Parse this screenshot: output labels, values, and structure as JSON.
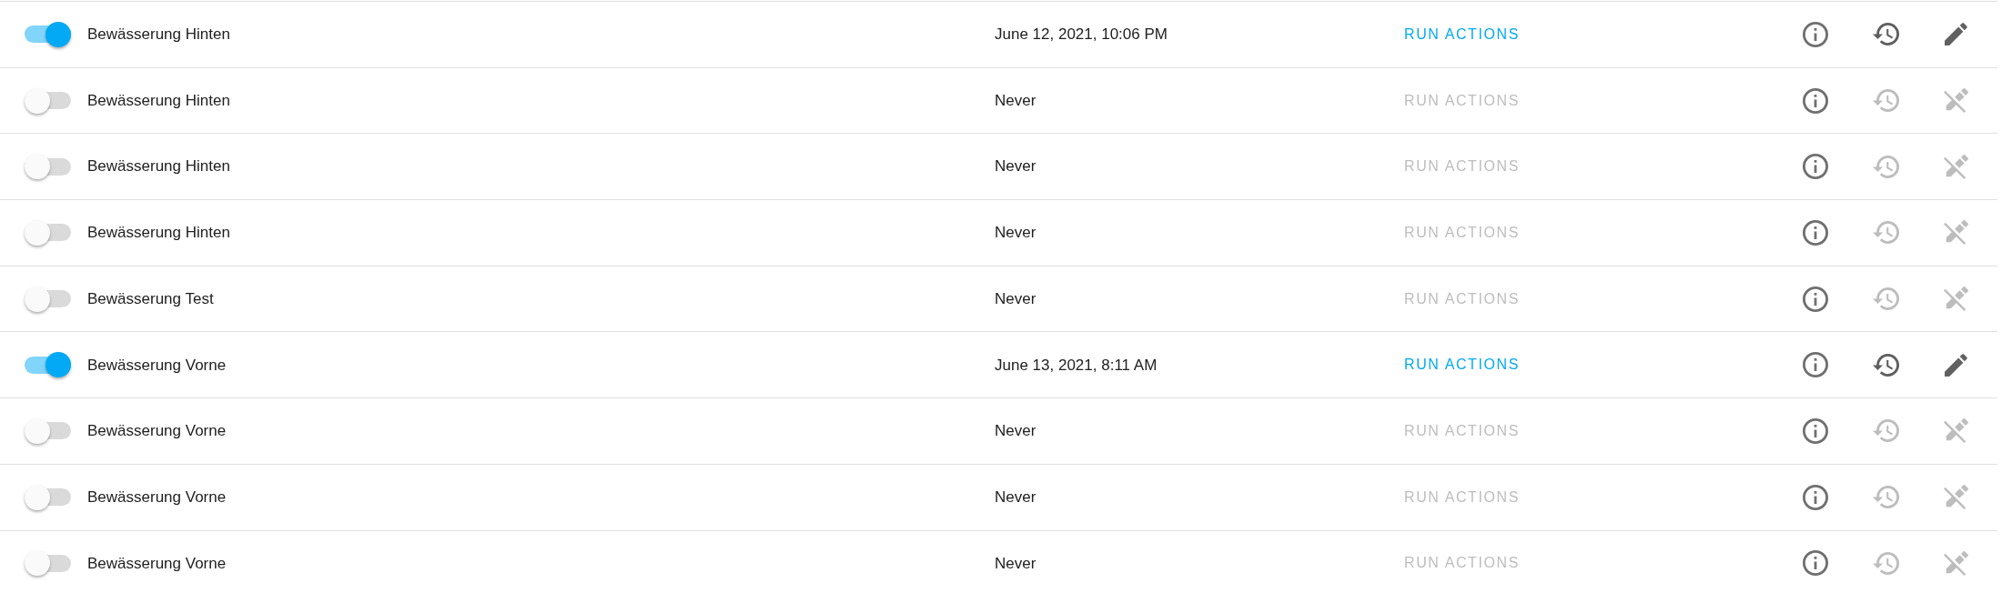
{
  "automations": [
    {
      "on": true,
      "name": "Bewässerung Hinten",
      "last_triggered": "June 12, 2021, 10:06 PM",
      "run_action": {
        "label": "RUN ACTIONS",
        "disabled": false
      },
      "history_disabled": false,
      "edit_disabled": false
    },
    {
      "on": false,
      "name": "Bewässerung Hinten",
      "last_triggered": "Never",
      "run_action": {
        "label": "RUN ACTIONS",
        "disabled": true
      },
      "history_disabled": true,
      "edit_disabled": true
    },
    {
      "on": false,
      "name": "Bewässerung Hinten",
      "last_triggered": "Never",
      "run_action": {
        "label": "RUN ACTIONS",
        "disabled": true
      },
      "history_disabled": true,
      "edit_disabled": true
    },
    {
      "on": false,
      "name": "Bewässerung Hinten",
      "last_triggered": "Never",
      "run_action": {
        "label": "RUN ACTIONS",
        "disabled": true
      },
      "history_disabled": true,
      "edit_disabled": true
    },
    {
      "on": false,
      "name": "Bewässerung Test",
      "last_triggered": "Never",
      "run_action": {
        "label": "RUN ACTIONS",
        "disabled": true
      },
      "history_disabled": true,
      "edit_disabled": true
    },
    {
      "on": true,
      "name": "Bewässerung Vorne",
      "last_triggered": "June 13, 2021, 8:11 AM",
      "run_action": {
        "label": "RUN ACTIONS",
        "disabled": false
      },
      "history_disabled": false,
      "edit_disabled": false
    },
    {
      "on": false,
      "name": "Bewässerung Vorne",
      "last_triggered": "Never",
      "run_action": {
        "label": "RUN ACTIONS",
        "disabled": true
      },
      "history_disabled": true,
      "edit_disabled": true
    },
    {
      "on": false,
      "name": "Bewässerung Vorne",
      "last_triggered": "Never",
      "run_action": {
        "label": "RUN ACTIONS",
        "disabled": true
      },
      "history_disabled": true,
      "edit_disabled": true
    },
    {
      "on": false,
      "name": "Bewässerung Vorne",
      "last_triggered": "Never",
      "run_action": {
        "label": "RUN ACTIONS",
        "disabled": true
      },
      "history_disabled": true,
      "edit_disabled": true
    }
  ]
}
